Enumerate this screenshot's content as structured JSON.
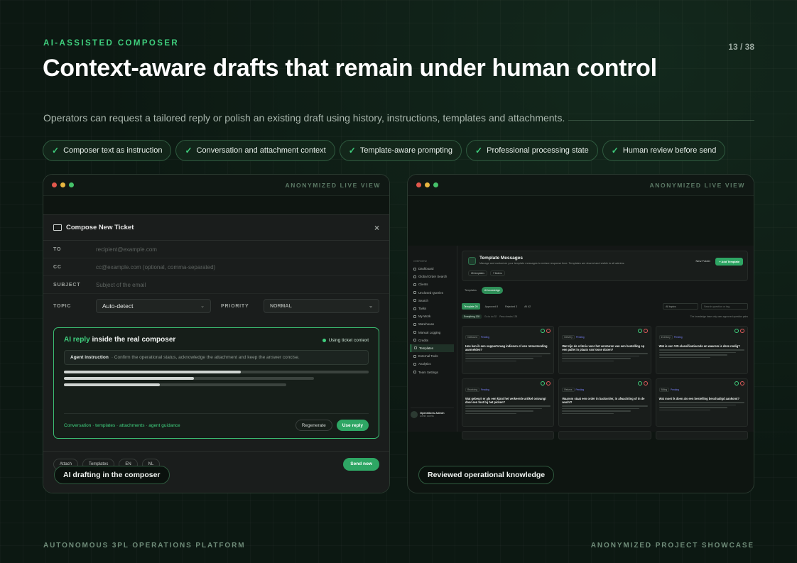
{
  "slide": {
    "eyebrow": "AI-ASSISTED COMPOSER",
    "page": "13 / 38",
    "title": "Context-aware drafts that remain under human control",
    "subtitle": "Operators can request a tailored reply or polish an existing draft using history, instructions, templates and attachments.",
    "chips": [
      "Composer text as instruction",
      "Conversation and attachment context",
      "Template-aware prompting",
      "Professional processing state",
      "Human review before send"
    ],
    "check_glyph": "✓",
    "footer_left": "AUTONOMOUS 3PL OPERATIONS PLATFORM",
    "footer_right": "ANONYMIZED PROJECT SHOWCASE"
  },
  "left_frame": {
    "tag": "ANONYMIZED LIVE VIEW",
    "caption": "AI drafting in the composer",
    "modal": {
      "title": "Compose New Ticket",
      "close": "×",
      "to_label": "TO",
      "to_placeholder": "recipient@example.com",
      "cc_label": "CC",
      "cc_placeholder": "cc@example.com (optional, comma-separated)",
      "subject_label": "SUBJECT",
      "subject_placeholder": "Subject of the email",
      "topic_label": "TOPIC",
      "topic_value": "Auto-detect",
      "priority_label": "PRIORITY",
      "priority_value": "NORMAL",
      "ai_title_accent": "AI reply",
      "ai_title_rest": " inside the real composer",
      "context_badge": "Using ticket context",
      "instruction_label": "Agent instruction",
      "instruction_text": "· Confirm the operational status, acknowledge the attachment and keep the answer concise.",
      "draft_progress": [
        0.58,
        0.52,
        0.43
      ],
      "sources": "Conversation · templates · attachments · agent guidance",
      "regenerate": "Regenerate",
      "use_reply": "Use reply",
      "attach": "Attach",
      "templates": "Templates",
      "lang_en": "EN",
      "lang_nl": "NL",
      "send": "Send now"
    }
  },
  "right_frame": {
    "tag": "ANONYMIZED LIVE VIEW",
    "caption": "Reviewed operational knowledge",
    "sidebar": {
      "group": "OVERVIEW",
      "items": [
        "Dashboard",
        "Global Order Search",
        "Clients",
        "Unclosed Queries",
        "Search",
        "Tasks",
        "My Work",
        "Warehouse",
        "Manual Logging",
        "Credits",
        "Templates",
        "External Tools",
        "Analytics",
        "Team Settings"
      ],
      "active_index": 10,
      "user_name": "Operations Admin",
      "user_role": "Admin access"
    },
    "header": {
      "title": "Template Messages",
      "subtitle": "Manage and customize your template messages to reduce response time. Templates are shared and visible to all admins.",
      "badge1": "26 templates",
      "badge2": "7 folders",
      "new_folder": "New Folder",
      "add_template": "+ Add Template"
    },
    "tabs": [
      "Templates",
      "AI knowledge"
    ],
    "active_tab": 1,
    "filters": [
      "Template 26",
      "Approved 8",
      "Rejected 3",
      "All 42"
    ],
    "folder_select": "All topics",
    "search_placeholder": "Search question or tag",
    "counts": [
      "Everything 128",
      "Go to do 32",
      "Pass checks 128"
    ],
    "counts_right": "The knowledge base only uses approved question pairs",
    "cards": [
      {
        "cat": "Outbound",
        "status": "Pending",
        "q": "Hoe kan ik een supportvraag indienen of een retourzending aanmelden?"
      },
      {
        "cat": "Delivery",
        "status": "Pending",
        "q": "Wat zijn de criteria voor het versturen van een bestelling op een pallet in plaats van losse dozen?"
      },
      {
        "cat": "Inventory",
        "status": "Pending",
        "q": "Wat is een VIS-classificatiecode en waarom is deze nodig?"
      },
      {
        "cat": "Receiving",
        "status": "Pending",
        "q": "Wat gebeurt er als een klant het verkeerde artikel ontvangt door een fout bij het picken?"
      },
      {
        "cat": "Returns",
        "status": "Pending",
        "q": "Waarom staat een order in backorder, in afwachting of in de wacht?"
      },
      {
        "cat": "Billing",
        "status": "Pending",
        "q": "Wat moet ik doen als een bestelling beschadigd aankomt?"
      }
    ]
  }
}
